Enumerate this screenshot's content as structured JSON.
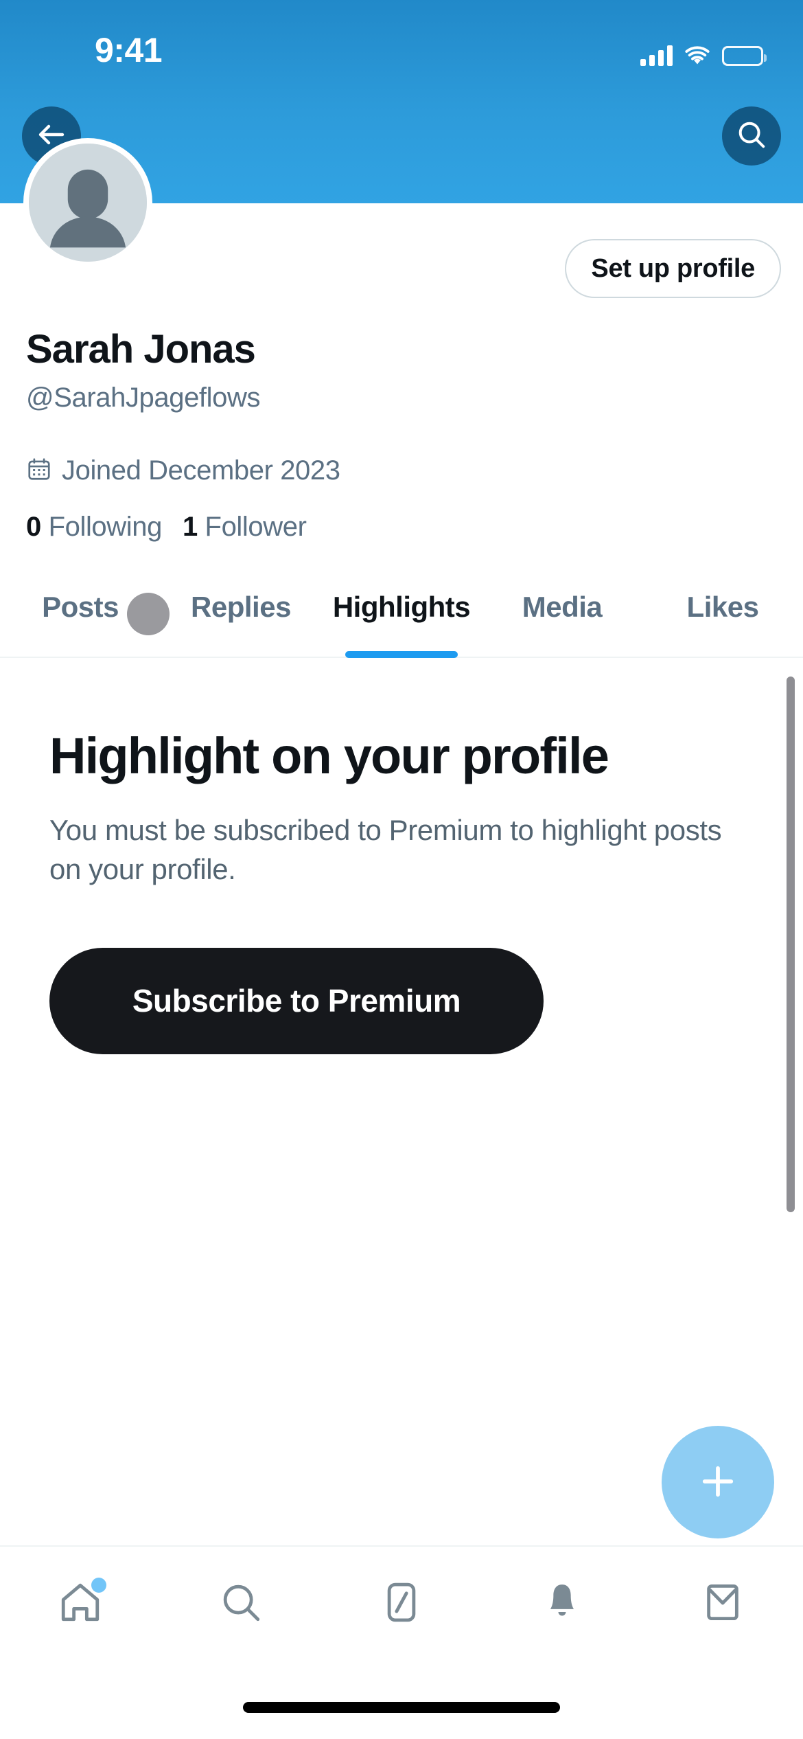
{
  "status_bar": {
    "time": "9:41",
    "cellular_icon": "signal-bars-icon",
    "wifi_icon": "wifi-icon",
    "battery_icon": "battery-full-icon"
  },
  "header": {
    "background_color": "#2d9bda",
    "back_button": "back-arrow-icon",
    "search_button": "search-icon"
  },
  "profile": {
    "avatar_icon": "default-avatar-icon",
    "setup_profile_label": "Set up profile",
    "display_name": "Sarah Jonas",
    "handle": "@SarahJpageflows",
    "joined_icon": "calendar-icon",
    "joined_text": "Joined December 2023",
    "stats": [
      {
        "count": "0",
        "label": "Following"
      },
      {
        "count": "1",
        "label": "Follower"
      }
    ]
  },
  "tabs": {
    "active_color": "#1d9bf0",
    "items": [
      {
        "label": "Posts",
        "active": false
      },
      {
        "label": "Replies",
        "active": false
      },
      {
        "label": "Highlights",
        "active": true
      },
      {
        "label": "Media",
        "active": false
      },
      {
        "label": "Likes",
        "active": false
      }
    ]
  },
  "empty_state": {
    "title": "Highlight on your profile",
    "description": "You must be subscribed to Premium to highlight posts on your profile.",
    "subscribe_label": "Subscribe to Premium",
    "subscribe_bg": "#16181c"
  },
  "compose": {
    "icon": "plus-icon",
    "background_color": "#8ecdf3"
  },
  "bottom_nav": {
    "items": [
      {
        "icon": "home-icon",
        "badge": true
      },
      {
        "icon": "search-icon",
        "badge": false
      },
      {
        "icon": "grok-icon",
        "badge": false
      },
      {
        "icon": "notifications-icon",
        "badge": false
      },
      {
        "icon": "messages-icon",
        "badge": false
      }
    ]
  },
  "scrollbar": {
    "visible": true
  }
}
